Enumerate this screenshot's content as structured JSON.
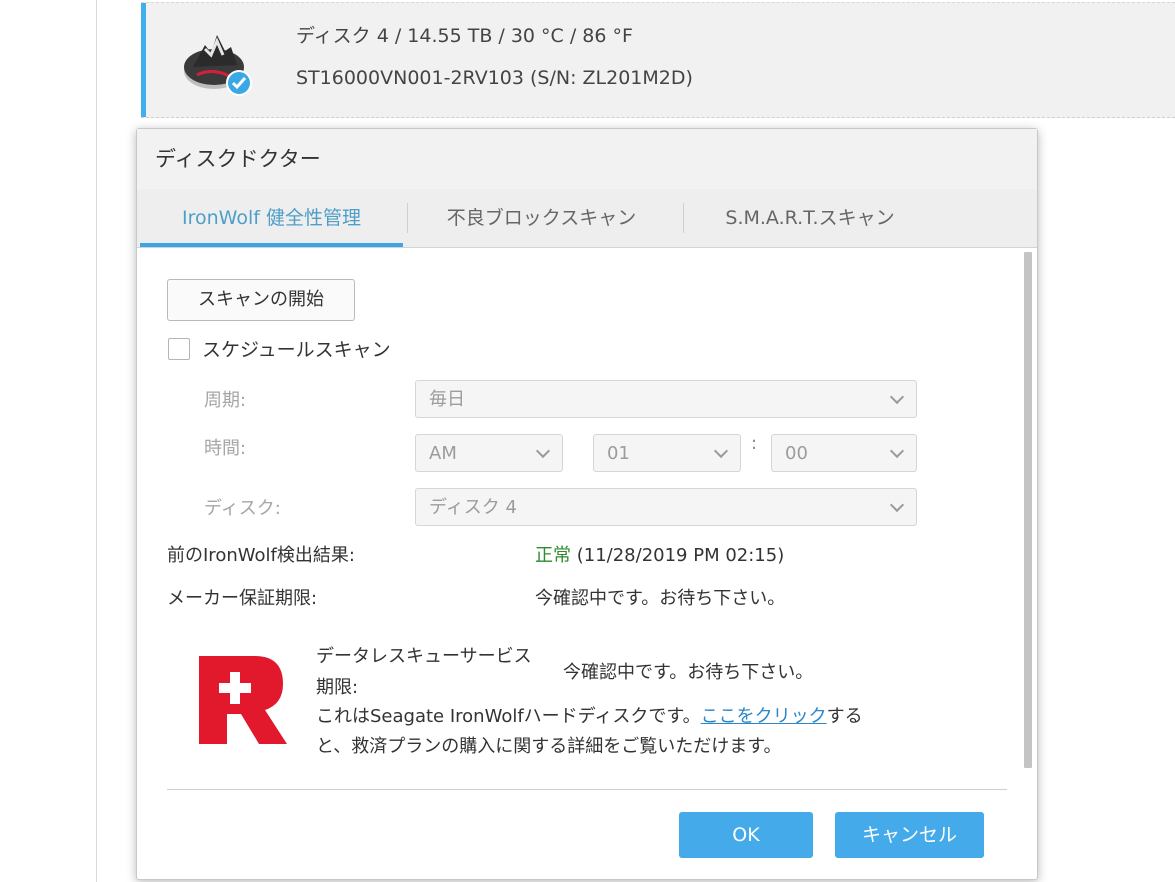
{
  "background": {
    "disk": {
      "line1": "ディスク 4 / 14.55 TB / 30 °C / 86 °F",
      "line2": "ST16000VN001-2RV103 (S/N: ZL201M2D)",
      "icon": "ironwolf-disk-icon",
      "status_icon": "check-badge-icon"
    }
  },
  "dialog": {
    "title": "ディスクドクター",
    "tabs": [
      {
        "label": "IronWolf 健全性管理",
        "active": true
      },
      {
        "label": "不良ブロックスキャン",
        "active": false
      },
      {
        "label": "S.M.A.R.T.スキャン",
        "active": false
      }
    ],
    "start_scan_label": "スキャンの開始",
    "schedule": {
      "checkbox_label": "スケジュールスキャン",
      "checked": false,
      "period_label": "周期:",
      "period_value": "毎日",
      "time_label": "時間:",
      "ampm_value": "AM",
      "hour_value": "01",
      "time_separator": ":",
      "minute_value": "00",
      "disk_label": "ディスク:",
      "disk_value": "ディスク 4"
    },
    "previous_result_label": "前のIronWolf検出結果:",
    "previous_result_status": "正常",
    "previous_result_time": "(11/28/2019 PM 02:15)",
    "warranty_label": "メーカー保証期限:",
    "warranty_value": "今確認中です。お待ち下さい。",
    "rescue": {
      "label_line1": "データレスキューサービス",
      "label_line2": "期限:",
      "value": "今確認中です。お待ち下さい。",
      "text_before_link": "これはSeagate IronWolfハードディスクです。",
      "link_text": "ここをクリック",
      "text_after_link": "する",
      "text_line2": "と、救済プランの購入に関する詳細をご覧いただけます。",
      "logo": "rescue-r-logo"
    },
    "ok_label": "OK",
    "cancel_label": "キャンセル"
  },
  "colors": {
    "accent": "#3fa4e5",
    "primary_button": "#44aaea",
    "success": "#2e8b2e",
    "rescue_red": "#e2182c"
  }
}
